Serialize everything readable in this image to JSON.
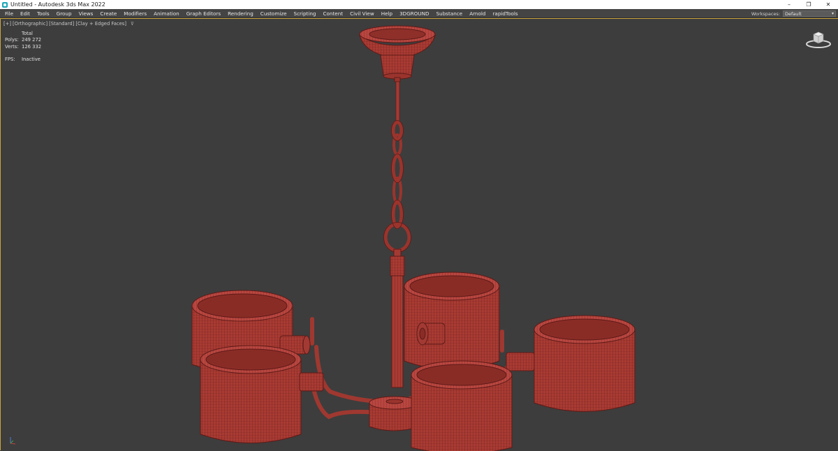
{
  "window": {
    "title": "Untitled - Autodesk 3ds Max 2022",
    "controls": {
      "minimize": "–",
      "restore": "❐",
      "close": "✕"
    }
  },
  "menu": {
    "items": [
      "File",
      "Edit",
      "Tools",
      "Group",
      "Views",
      "Create",
      "Modifiers",
      "Animation",
      "Graph Editors",
      "Rendering",
      "Customize",
      "Scripting",
      "Content",
      "Civil View",
      "Help",
      "3DGROUND",
      "Substance",
      "Arnold",
      "rapidTools"
    ],
    "workspace_label": "Workspaces:",
    "workspace_value": "Default"
  },
  "viewport": {
    "label_parts": [
      "[+]",
      "[Orthographic]",
      "[Standard]",
      "[Clay + Edged Faces]"
    ],
    "filter_icon": "funnel-icon",
    "filter_glyph": "⊽",
    "stats": {
      "header": "Total",
      "polys_label": "Polys:",
      "polys_value": "249 272",
      "verts_label": "Verts:",
      "verts_value": "126 332",
      "fps_label": "FPS:",
      "fps_value": "Inactive"
    },
    "viewcube_icon": "viewcube-icon",
    "axis_icon": "axis-tripod-icon"
  },
  "colors": {
    "mesh": "#a33a33",
    "wire": "#6e1f1c",
    "background": "#3d3d3d",
    "active_border": "#c9a53a"
  }
}
